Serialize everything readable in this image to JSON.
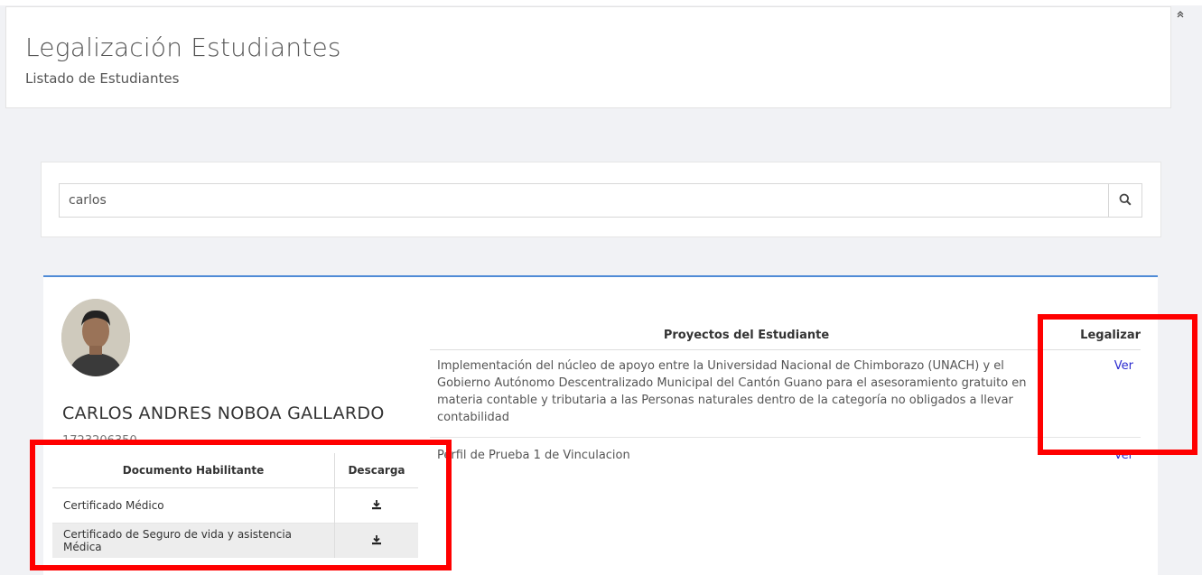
{
  "header": {
    "title": "Legalización Estudiantes",
    "subtitle": "Listado de Estudiantes",
    "collapse_icon": "collapse-icon"
  },
  "search": {
    "value": "carlos",
    "button_icon": "search-icon"
  },
  "student": {
    "name": "CARLOS ANDRES NOBOA GALLARDO",
    "id_number": "1723206350",
    "avatar_icon": "student-photo"
  },
  "documents": {
    "columns": [
      "Documento Habilitante",
      "Descarga"
    ],
    "rows": [
      {
        "name": "Certificado Médico",
        "download_icon": "download-icon"
      },
      {
        "name": "Certificado de Seguro de vida y asistencia Médica",
        "download_icon": "download-icon"
      }
    ]
  },
  "projects": {
    "columns": [
      "Proyectos del Estudiante",
      "Legalizar"
    ],
    "rows": [
      {
        "name": "Implementación del núcleo de apoyo entre la Universidad Nacional de Chimborazo (UNACH) y el Gobierno Autónomo Descentralizado Municipal del Cantón Guano para el asesoramiento gratuito en materia contable y tributaria a las Personas naturales dentro de la categoría no obligados a llevar contabilidad",
        "action": "Ver"
      },
      {
        "name": "Perfil de Prueba 1 de Vinculacion",
        "action": "Ver"
      }
    ]
  },
  "colors": {
    "accent": "#4f8bd6",
    "link": "#2b2bcf",
    "highlight": "#ff0000"
  }
}
